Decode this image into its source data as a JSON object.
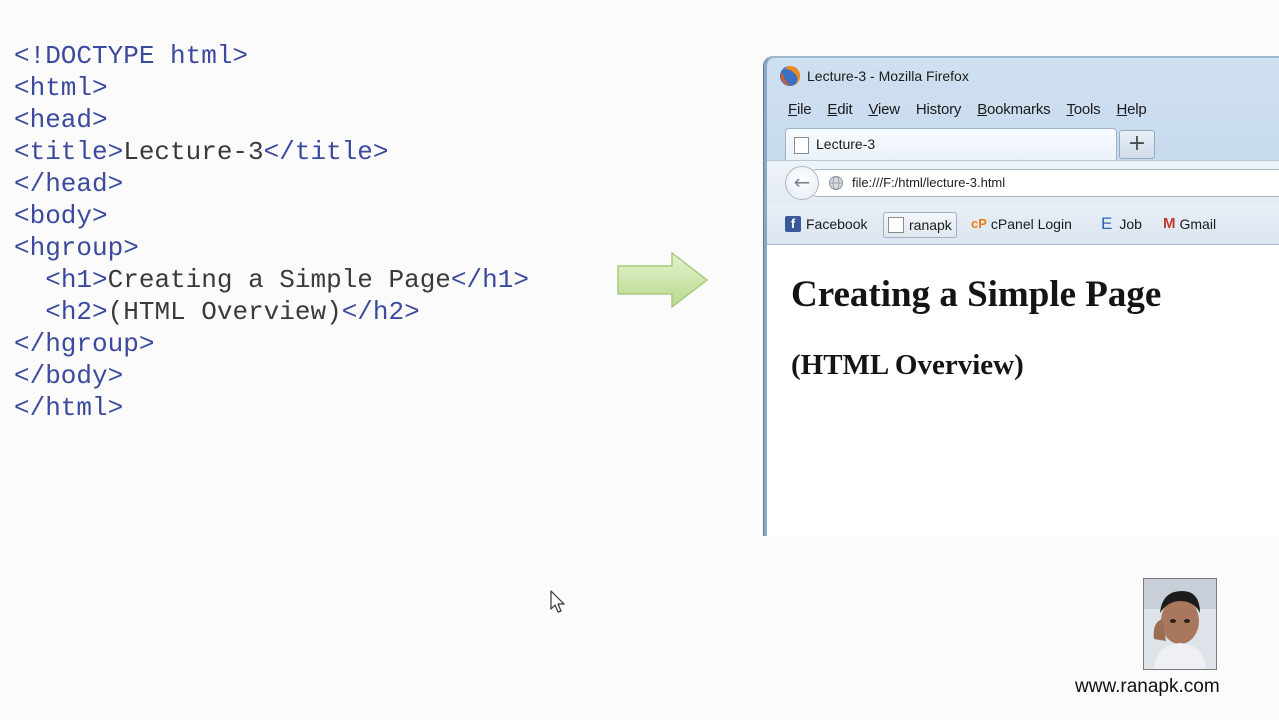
{
  "code": {
    "lines": [
      {
        "indent": "",
        "tag_open": "<!DOCTYPE html>",
        "text": "",
        "tag_close": ""
      },
      {
        "indent": "",
        "tag_open": "<html>",
        "text": "",
        "tag_close": ""
      },
      {
        "indent": "",
        "tag_open": "<head>",
        "text": "",
        "tag_close": ""
      },
      {
        "indent": "",
        "tag_open": "<title>",
        "text": "Lecture-3",
        "tag_close": "</title>"
      },
      {
        "indent": "",
        "tag_open": "</head>",
        "text": "",
        "tag_close": ""
      },
      {
        "indent": "",
        "tag_open": "<body>",
        "text": "",
        "tag_close": ""
      },
      {
        "indent": "",
        "tag_open": "<hgroup>",
        "text": "",
        "tag_close": ""
      },
      {
        "indent": "  ",
        "tag_open": "<h1>",
        "text": "Creating a Simple Page",
        "tag_close": "</h1>"
      },
      {
        "indent": "  ",
        "tag_open": "<h2>",
        "text": "(HTML Overview)",
        "tag_close": "</h2>"
      },
      {
        "indent": "",
        "tag_open": "</hgroup>",
        "text": "",
        "tag_close": ""
      },
      {
        "indent": "",
        "tag_open": "</body>",
        "text": "",
        "tag_close": ""
      },
      {
        "indent": "",
        "tag_open": "</html>",
        "text": "",
        "tag_close": ""
      }
    ]
  },
  "arrow": {
    "icon": "right-arrow-icon",
    "color": "#c8e6a3"
  },
  "browser": {
    "window_title": "Lecture-3 - Mozilla Firefox",
    "menu": [
      {
        "mnemonic": "F",
        "rest": "ile"
      },
      {
        "mnemonic": "E",
        "rest": "dit"
      },
      {
        "mnemonic": "V",
        "rest": "iew"
      },
      {
        "mnemonic": "",
        "rest": "History"
      },
      {
        "mnemonic": "B",
        "rest": "ookmarks"
      },
      {
        "mnemonic": "T",
        "rest": "ools"
      },
      {
        "mnemonic": "H",
        "rest": "elp"
      }
    ],
    "tab_label": "Lecture-3",
    "new_tab_symbol": "+",
    "back_symbol": "←",
    "url": "file:///F:/html/lecture-3.html",
    "bookmarks": {
      "facebook": "Facebook",
      "ranapk": "ranapk",
      "cpanel": "cPanel Login",
      "job": "Job",
      "gmail": "Gmail",
      "facebook_icon": "f",
      "cpanel_icon": "cP",
      "job_icon": "E",
      "gmail_icon": "M"
    },
    "page": {
      "h1": "Creating a Simple Page",
      "h2": "(HTML Overview)"
    }
  },
  "footer": {
    "website": "www.ranapk.com"
  }
}
